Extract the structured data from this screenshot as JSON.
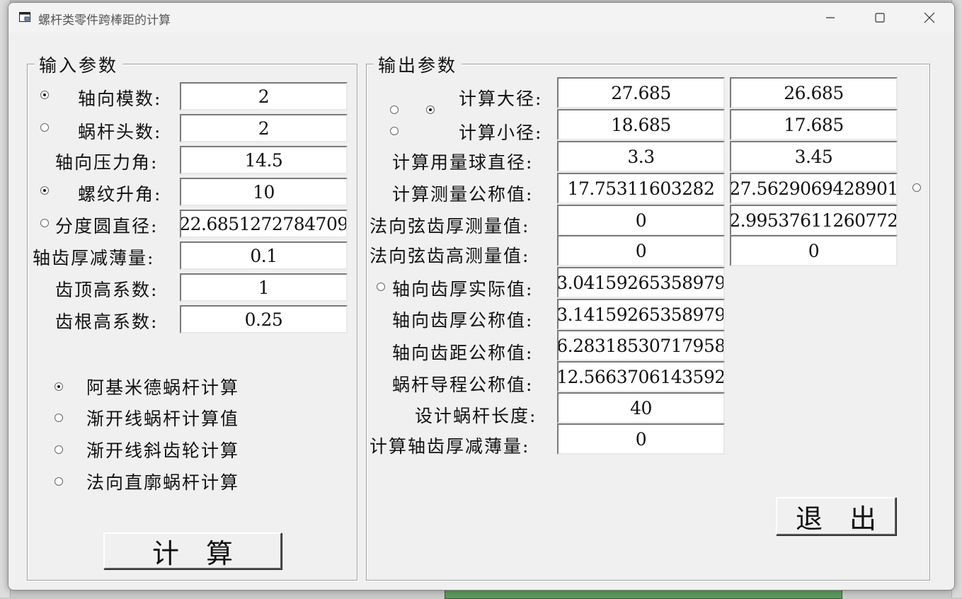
{
  "window": {
    "title": "螺杆类零件跨棒距的计算"
  },
  "input": {
    "group_title": "输入参数",
    "rows": [
      {
        "label": "轴向模数:",
        "value": "2"
      },
      {
        "label": "蜗杆头数:",
        "value": "2"
      },
      {
        "label": "轴向压力角:",
        "value": "14.5"
      },
      {
        "label": "螺纹升角:",
        "value": "10"
      },
      {
        "label": "分度圆直径:",
        "value": "22.6851272784709"
      },
      {
        "label": "轴齿厚减薄量:",
        "value": "0.1"
      },
      {
        "label": "齿顶高系数:",
        "value": "1"
      },
      {
        "label": "齿根高系数:",
        "value": "0.25"
      }
    ],
    "modes": [
      {
        "label": "阿基米德蜗杆计算",
        "selected": true
      },
      {
        "label": "渐开线蜗杆计算值",
        "selected": false
      },
      {
        "label": "渐开线斜齿轮计算",
        "selected": false
      },
      {
        "label": "法向直廓蜗杆计算",
        "selected": false
      }
    ],
    "calc_button": "计　算"
  },
  "output": {
    "group_title": "输出参数",
    "rows": [
      {
        "label": "计算大径:",
        "v1": "27.685",
        "v2": "26.685"
      },
      {
        "label": "计算小径:",
        "v1": "18.685",
        "v2": "17.685"
      },
      {
        "label": "计算用量球直径:",
        "v1": "3.3",
        "v2": "3.45"
      },
      {
        "label": "计算测量公称值:",
        "v1": "17.75311603282",
        "v2": "27.5629069428901"
      },
      {
        "label": "法向弦齿厚测量值:",
        "v1": "0",
        "v2": "2.99537611260772"
      },
      {
        "label": "法向弦齿高测量值:",
        "v1": "0",
        "v2": "0"
      },
      {
        "label": "轴向齿厚实际值:",
        "v1": "3.04159265358979"
      },
      {
        "label": "轴向齿厚公称值:",
        "v1": "3.14159265358979"
      },
      {
        "label": "轴向齿距公称值:",
        "v1": "6.28318530717958"
      },
      {
        "label": "蜗杆导程公称值:",
        "v1": "12.5663706143592"
      },
      {
        "label": "设计蜗杆长度:",
        "v1": "40"
      },
      {
        "label": "计算轴齿厚减薄量:",
        "v1": "0"
      }
    ],
    "exit_button": "退　出"
  }
}
